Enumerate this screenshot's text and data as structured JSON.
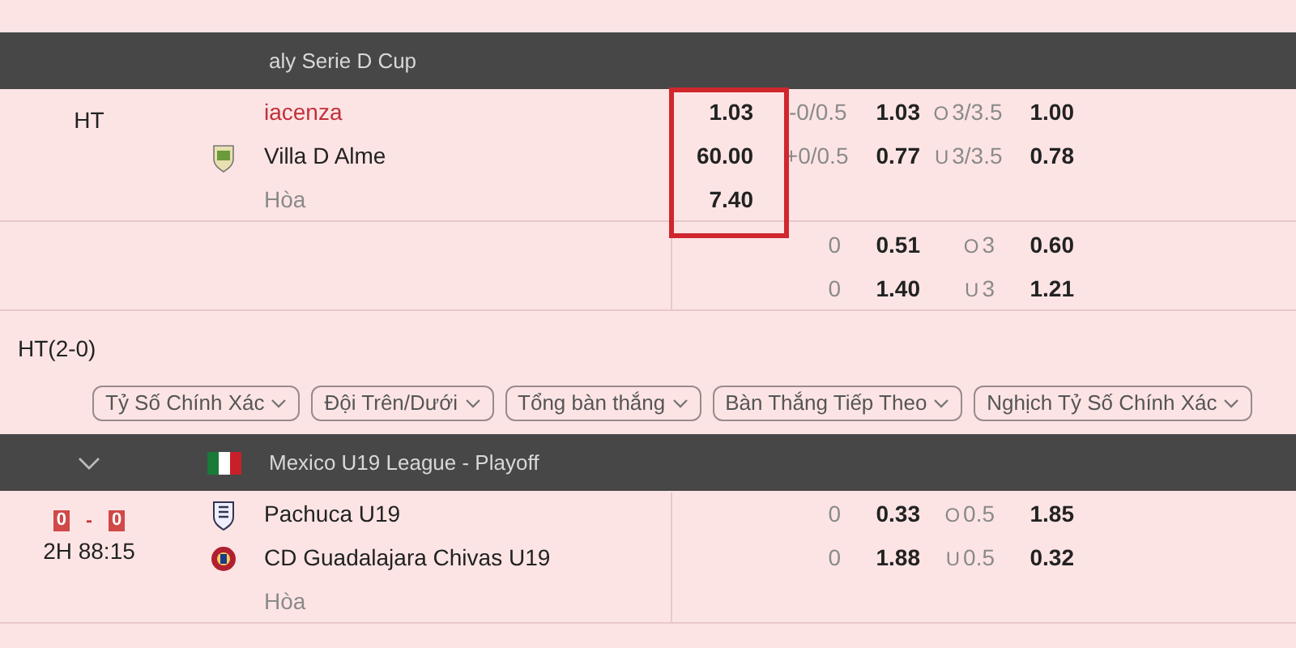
{
  "blocks": [
    {
      "kind": "league",
      "name": "aly Serie D Cup",
      "controls": false,
      "rows": [
        {
          "kind": "match",
          "status": "HT",
          "home": "iacenza",
          "home_highlight": true,
          "away": "Villa D Alme",
          "draw": "Hòa",
          "odds_1x2": [
            "1.03",
            "60.00",
            "7.40"
          ],
          "handicap": [
            {
              "line": "-0/0.5",
              "odds": "1.03"
            },
            {
              "line": "+0/0.5",
              "odds": "0.77"
            }
          ],
          "over_under": [
            {
              "side": "O",
              "line": "3/3.5",
              "odds": "1.00"
            },
            {
              "side": "U",
              "line": "3/3.5",
              "odds": "0.78"
            }
          ]
        },
        {
          "kind": "extra",
          "handicap": [
            {
              "line": "0",
              "odds": "0.51"
            },
            {
              "line": "0",
              "odds": "1.40"
            }
          ],
          "over_under": [
            {
              "side": "O",
              "line": "3",
              "odds": "0.60"
            },
            {
              "side": "U",
              "line": "3",
              "odds": "1.21"
            }
          ]
        }
      ]
    },
    {
      "kind": "note",
      "text": "HT(2-0)"
    },
    {
      "kind": "filters",
      "items": [
        "Tỷ Số Chính Xác",
        "Đội Trên/Dưới",
        "Tổng bàn thắng",
        "Bàn Thắng Tiếp Theo",
        "Nghịch Tỷ Số Chính Xác"
      ]
    },
    {
      "kind": "league",
      "name": "Mexico U19 League - Playoff",
      "controls": true,
      "rows": [
        {
          "kind": "match",
          "status": "2H 88:15",
          "score": [
            "0",
            "-",
            "0"
          ],
          "home": "Pachuca U19",
          "home_highlight": false,
          "away": "CD Guadalajara Chivas U19",
          "draw": "Hòa",
          "handicap": [
            {
              "line": "0",
              "odds": "0.33"
            },
            {
              "line": "0",
              "odds": "1.88"
            }
          ],
          "over_under": [
            {
              "side": "O",
              "line": "0.5",
              "odds": "1.85"
            },
            {
              "side": "U",
              "line": "0.5",
              "odds": "0.32"
            }
          ]
        }
      ]
    }
  ]
}
